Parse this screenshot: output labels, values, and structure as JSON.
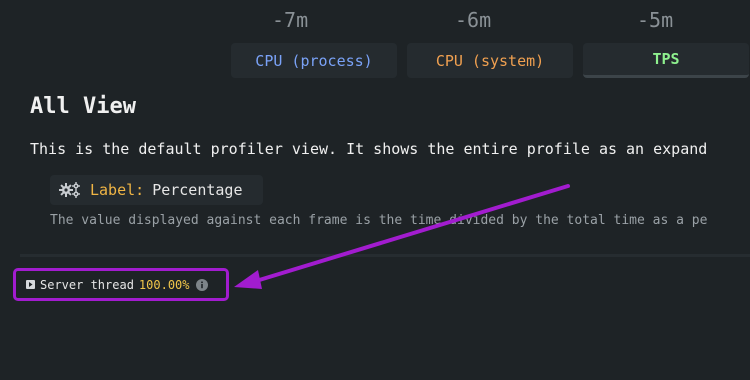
{
  "timeline": {
    "labels": [
      "-7m",
      "-6m",
      "-5m"
    ]
  },
  "tabs": [
    {
      "label": "CPU (process)",
      "color": "#7aa2f7"
    },
    {
      "label": "CPU (system)",
      "color": "#f0a050"
    },
    {
      "label": "TPS",
      "color": "#8ef08e",
      "active": true
    }
  ],
  "view": {
    "title": "All View",
    "description": "This is the default profiler view. It shows the entire profile as an expand"
  },
  "label_info": {
    "icon": "gears-icon",
    "key": "Label:",
    "value": "Percentage",
    "description": "The value displayed against each frame is the time divided by the total time as a pe"
  },
  "thread": {
    "expand_icon": "expand-icon",
    "name": "Server thread",
    "percentage": "100.00%",
    "info_icon": "info-icon"
  },
  "colors": {
    "background": "#1e2326",
    "highlight": "#a21ccf",
    "label_key": "#f0b545",
    "percentage": "#f0c64a"
  }
}
